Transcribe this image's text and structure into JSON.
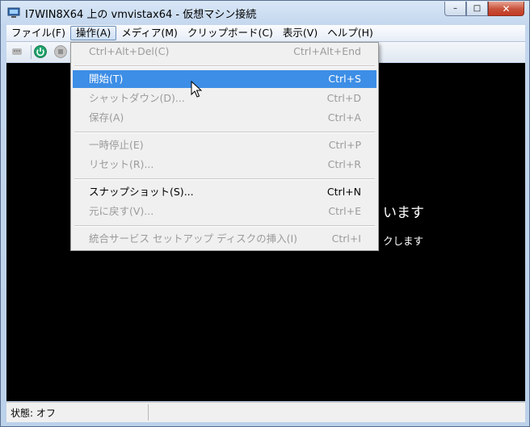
{
  "window": {
    "title": "I7WIN8X64 上の vmvistax64 - 仮想マシン接続"
  },
  "caption_buttons": {
    "minimize": "–",
    "maximize": "□",
    "close": "✕"
  },
  "menubar": {
    "items": [
      "ファイル(F)",
      "操作(A)",
      "メディア(M)",
      "クリップボード(C)",
      "表示(V)",
      "ヘルプ(H)"
    ]
  },
  "dropdown": {
    "items": [
      {
        "label": "Ctrl+Alt+Del(C)",
        "shortcut": "Ctrl+Alt+End",
        "enabled": false
      },
      {
        "label": "開始(T)",
        "shortcut": "Ctrl+S",
        "enabled": true,
        "highlighted": true
      },
      {
        "label": "シャットダウン(D)...",
        "shortcut": "Ctrl+D",
        "enabled": false
      },
      {
        "label": "保存(A)",
        "shortcut": "Ctrl+A",
        "enabled": false
      },
      {
        "label": "一時停止(E)",
        "shortcut": "Ctrl+P",
        "enabled": false
      },
      {
        "label": "リセット(R)...",
        "shortcut": "Ctrl+R",
        "enabled": false
      },
      {
        "label": "スナップショット(S)...",
        "shortcut": "Ctrl+N",
        "enabled": true
      },
      {
        "label": "元に戻す(V)...",
        "shortcut": "Ctrl+E",
        "enabled": false
      },
      {
        "label": "統合サービス セットアップ ディスクの挿入(I)",
        "shortcut": "Ctrl+I",
        "enabled": false
      }
    ]
  },
  "screen": {
    "line1": "います",
    "line2": "クします"
  },
  "statusbar": {
    "text": "状態: オフ"
  },
  "colors": {
    "highlight": "#3d8ee6",
    "start_icon": "#1ea36b",
    "disabled_text": "#9b9b9b"
  }
}
